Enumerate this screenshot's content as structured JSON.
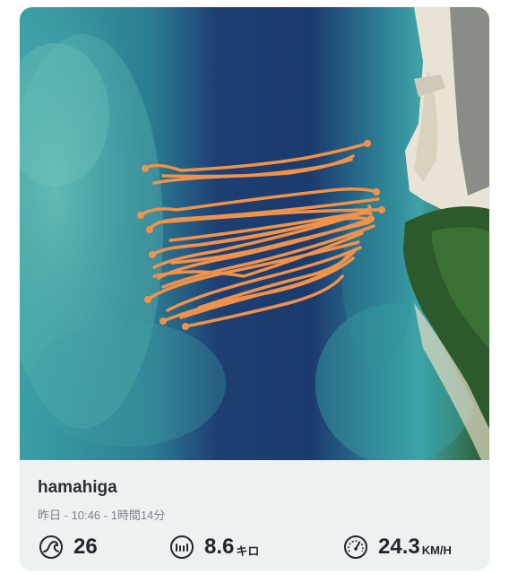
{
  "session": {
    "spot_name": "hamahiga",
    "date_label": "昨日",
    "time": "10:46",
    "duration": "1時間14分"
  },
  "stats": {
    "waves": {
      "value": "26",
      "unit": "",
      "icon": "wave-icon"
    },
    "distance": {
      "value": "8.6",
      "unit": "キロ",
      "icon": "ruler-icon"
    },
    "speed": {
      "value": "24.3",
      "unit": "KM/H",
      "icon": "speedometer-icon"
    }
  },
  "colors": {
    "track": "#f0924a",
    "deep_water": "#1d3f73",
    "shallow_water": "#3ea3a8",
    "reef": "#5fb9b2",
    "land": "#2c5a2a",
    "sand": "#e9e3d5",
    "info_bg": "#eef1f2",
    "text_primary": "#2a2f33",
    "text_secondary": "#7c8388"
  }
}
